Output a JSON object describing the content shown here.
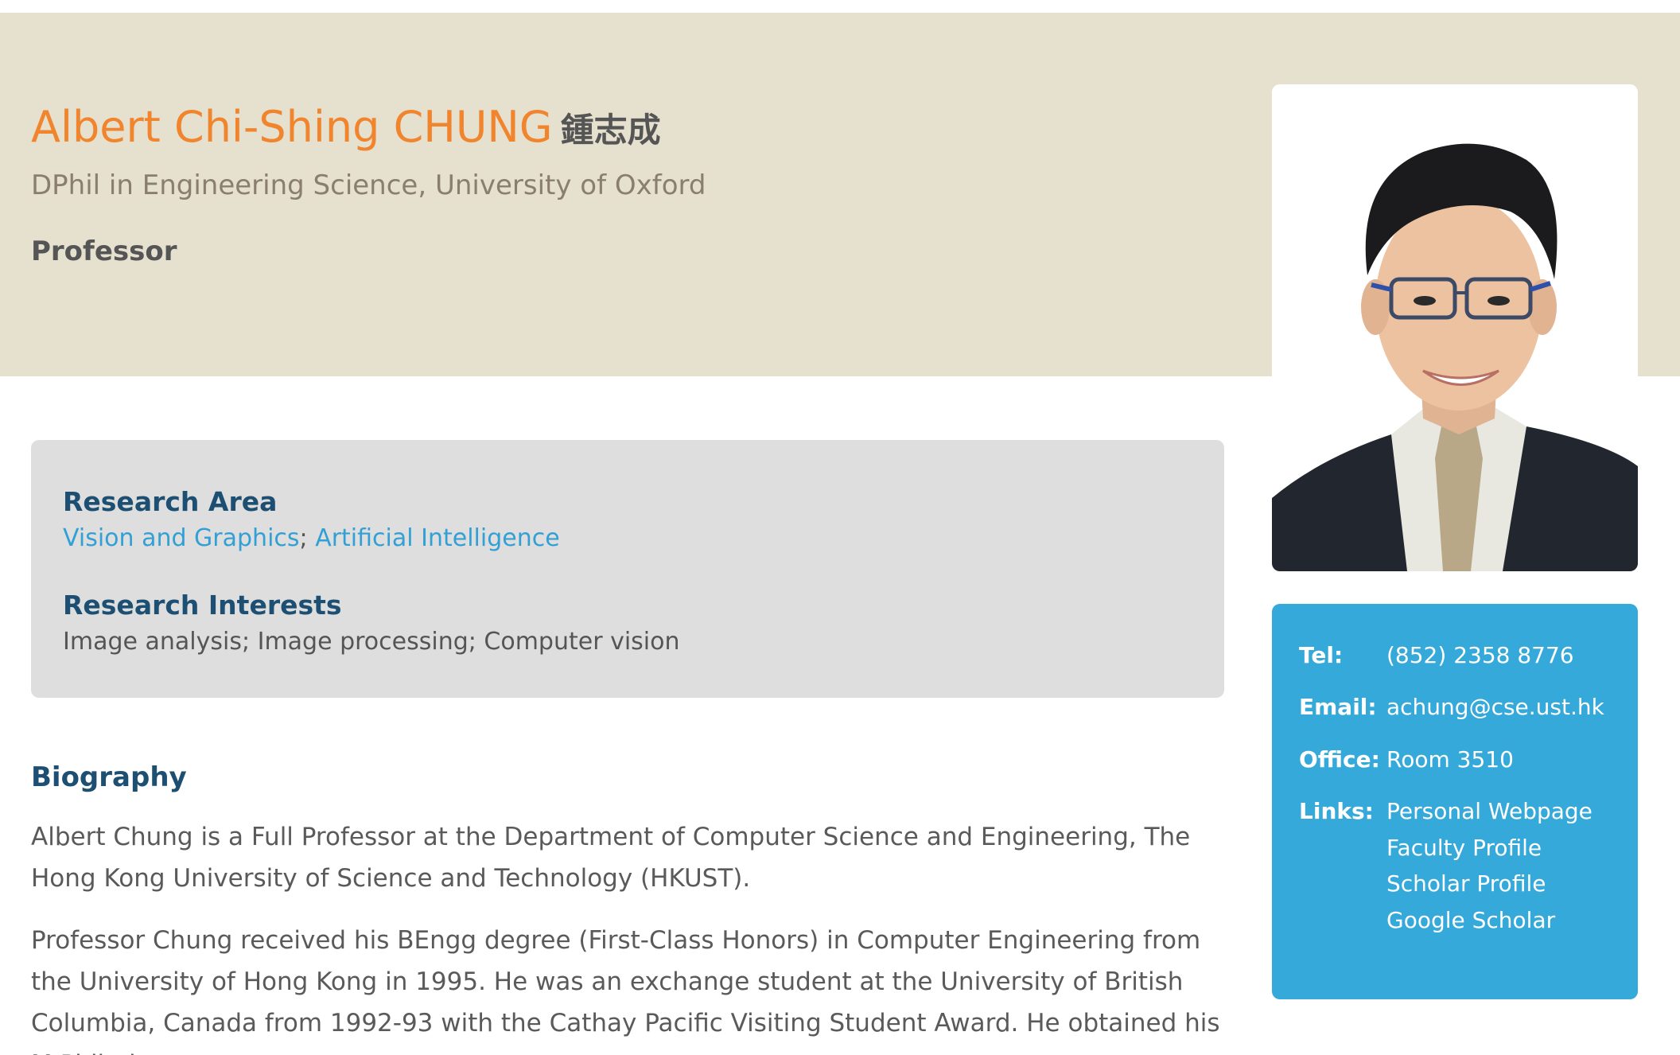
{
  "profile": {
    "name": "Albert Chi-Shing CHUNG",
    "chinese_name": "鍾志成",
    "degree": "DPhil in Engineering Science, University of Oxford",
    "position": "Professor"
  },
  "research": {
    "area_heading": "Research Area",
    "areas": [
      "Vision and Graphics",
      "Artificial Intelligence"
    ],
    "area_separator": "; ",
    "interests_heading": "Research Interests",
    "interests": "Image analysis; Image processing; Computer vision"
  },
  "contact": {
    "tel_label": "Tel:",
    "tel": "(852) 2358 8776",
    "email_label": "Email:",
    "email": "achung@cse.ust.hk",
    "office_label": "Office:",
    "office": "Room 3510",
    "links_label": "Links:",
    "links": [
      "Personal Webpage",
      "Faculty Profile",
      "Scholar Profile",
      "Google Scholar"
    ]
  },
  "biography": {
    "heading": "Biography",
    "paragraphs": [
      "Albert Chung is a Full Professor at the Department of Computer Science and Engineering, The Hong Kong University of Science and Technology (HKUST).",
      "Professor Chung received his BEngg degree (First-Class Honors) in Computer Engineering from the University of Hong Kong in 1995. He was an exchange student at the University of British Columbia, Canada from 1992-93 with the Cathay Pacific Visiting Student Award. He obtained his M.Phil. degree"
    ]
  },
  "colors": {
    "hero_bg": "#e6e0cf",
    "name_orange": "#f0852d",
    "heading_navy": "#1d4f73",
    "link_blue": "#32a0d4",
    "contact_bg": "#35a9da",
    "research_box_bg": "#dedede"
  }
}
